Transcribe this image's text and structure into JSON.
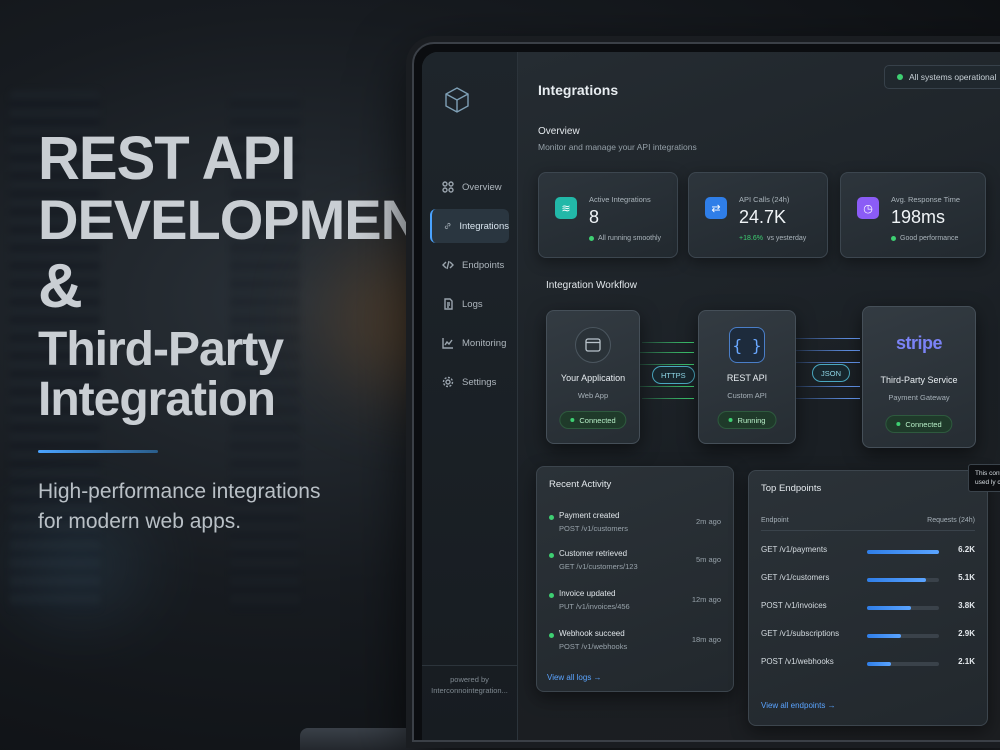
{
  "hero": {
    "line1": "REST API",
    "line2": "DEVELOPMENT",
    "amp": "&",
    "line3": "Third-Party",
    "line4": "Integration",
    "tagline1": "High-performance integrations",
    "tagline2": "for modern web apps."
  },
  "colors": {
    "accent": "#4aa3ff",
    "success": "#3ecf72",
    "purple": "#8b5cf6",
    "teal": "#22b8a8",
    "blue": "#2f7ee8",
    "stripe": "#7b83f6"
  },
  "sidebar": {
    "items": [
      {
        "label": "Overview",
        "icon": "grid-icon"
      },
      {
        "label": "Integrations",
        "icon": "link-icon"
      },
      {
        "label": "Endpoints",
        "icon": "code-icon"
      },
      {
        "label": "Logs",
        "icon": "document-icon"
      },
      {
        "label": "Monitoring",
        "icon": "chart-line-icon"
      },
      {
        "label": "Settings",
        "icon": "gear-icon"
      }
    ],
    "powered_line1": "powered by",
    "powered_line2": "Interconnointegration..."
  },
  "header": {
    "title": "Integrations",
    "status": "All systems operational"
  },
  "overview": {
    "title": "Overview",
    "subtitle": "Monitor and manage your API integrations"
  },
  "stats": [
    {
      "label": "Active Integrations",
      "value": "8",
      "sub": "All running smoothly",
      "icon": "layers-icon"
    },
    {
      "label": "API Calls (24h)",
      "value": "24.7K",
      "sub_up": "+18.6%",
      "sub": "vs yesterday",
      "icon": "swap-icon"
    },
    {
      "label": "Avg. Response Time",
      "value": "198ms",
      "sub": "Good performance",
      "icon": "clock-icon"
    }
  ],
  "workflow": {
    "title": "Integration Workflow",
    "nodes": [
      {
        "title": "Your Application",
        "subtitle": "Web App",
        "status": "Connected"
      },
      {
        "title": "REST API",
        "subtitle": "Custom API",
        "status": "Running",
        "glyph": "{ }"
      },
      {
        "title": "Third-Party Service",
        "subtitle": "Payment Gateway",
        "status": "Connected",
        "logo": "stripe"
      }
    ],
    "conn1": "HTTPS",
    "conn2": "JSON"
  },
  "tooltip": "This conveloattan interaction used ly consent our tooltips.",
  "activity": {
    "title": "Recent Activity",
    "items": [
      {
        "title": "Payment created",
        "path": "POST /v1/customers",
        "time": "2m ago"
      },
      {
        "title": "Customer retrieved",
        "path": "GET /v1/customers/123",
        "time": "5m ago"
      },
      {
        "title": "Invoice updated",
        "path": "PUT /v1/invoices/456",
        "time": "12m ago"
      },
      {
        "title": "Webhook succeed",
        "path": "POST /v1/webhooks",
        "time": "18m ago"
      }
    ],
    "link": "View all logs →"
  },
  "endpoints": {
    "title": "Top Endpoints",
    "col1": "Endpoint",
    "col2": "Requests (24h)",
    "rows": [
      {
        "name": "GET /v1/payments",
        "value": "6.2K",
        "fill": 1.0
      },
      {
        "name": "GET /v1/customers",
        "value": "5.1K",
        "fill": 0.82
      },
      {
        "name": "POST /v1/invoices",
        "value": "3.8K",
        "fill": 0.61
      },
      {
        "name": "GET /v1/subscriptions",
        "value": "2.9K",
        "fill": 0.47
      },
      {
        "name": "POST /v1/webhooks",
        "value": "2.1K",
        "fill": 0.34
      }
    ],
    "link": "View all endpoints →"
  }
}
